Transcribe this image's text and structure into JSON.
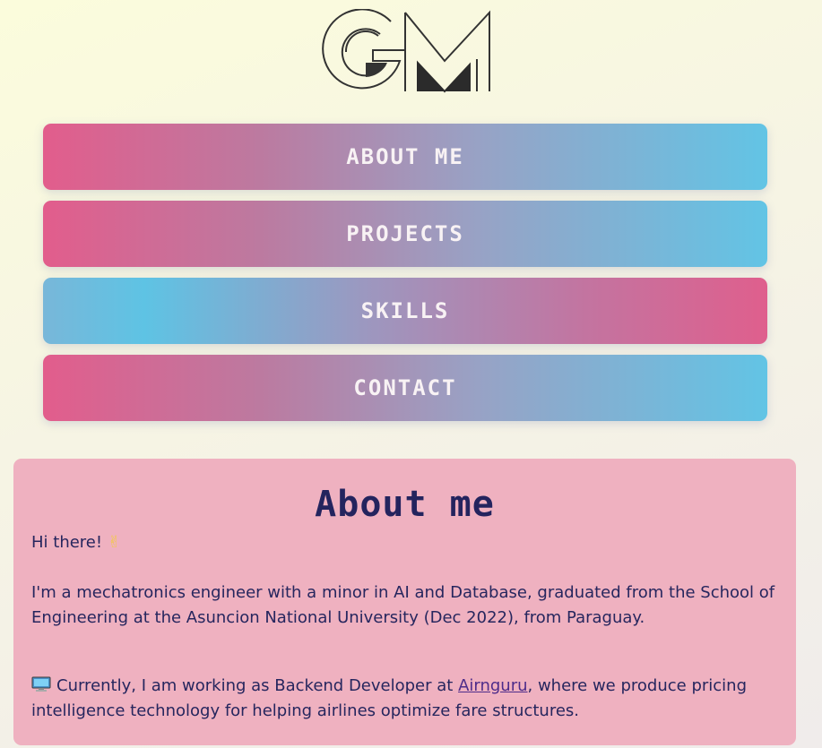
{
  "logo": {
    "letters": "GM"
  },
  "nav": {
    "about_label": "About me",
    "projects_label": "Projects",
    "skills_label": "Skills",
    "contact_label": "Contact"
  },
  "about": {
    "title": "About me",
    "greeting": "Hi there!",
    "greeting_emoji": "✌",
    "intro": "I'm a mechatronics engineer with a minor in AI and Database, graduated from the School of Engineering at the Asuncion National University (Dec 2022), from Paraguay.",
    "current_prefix": "Currently, I am working as Backend Developer at ",
    "company_link": "Airnguru",
    "current_suffix": ", where we produce pricing intelligence technology for helping airlines optimize fare structures."
  },
  "colors": {
    "pink": "#e25d8c",
    "blue": "#62c4e5",
    "card": "#efb1c0",
    "text": "#26265e"
  },
  "icons": [
    "gm-logo",
    "victory-hand-icon",
    "computer-icon"
  ]
}
